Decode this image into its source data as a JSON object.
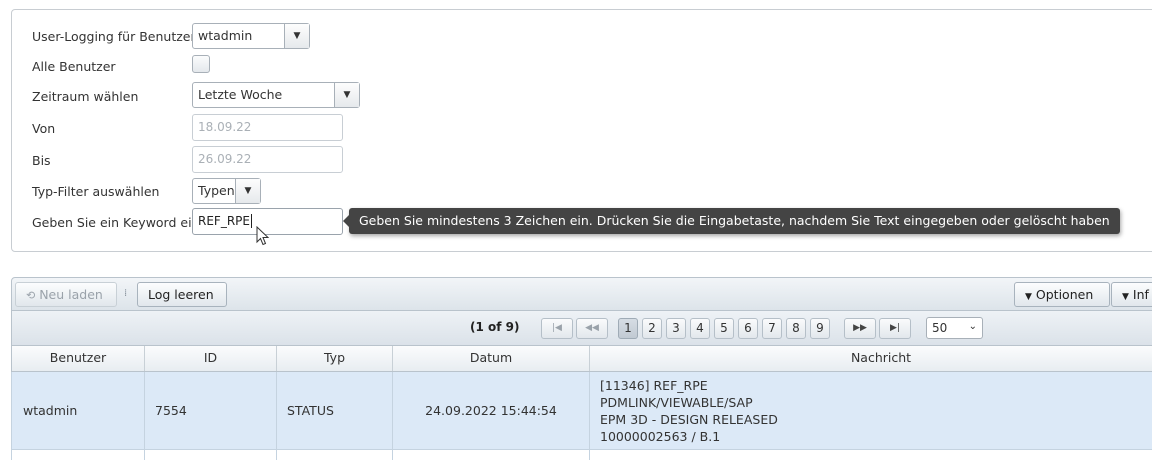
{
  "form": {
    "user_label": "User-Logging für Benutzer",
    "user_value": "wtadmin",
    "all_users_label": "Alle Benutzer",
    "period_label": "Zeitraum wählen",
    "period_value": "Letzte Woche",
    "from_label": "Von",
    "from_value": "18.09.22",
    "to_label": "Bis",
    "to_value": "26.09.22",
    "type_filter_label": "Typ-Filter auswählen",
    "type_filter_value": "Typen",
    "keyword_label": "Geben Sie ein Keyword ein",
    "keyword_value": "REF_RPE",
    "keyword_tooltip": "Geben Sie mindestens 3 Zeichen ein. Drücken Sie die Eingabetaste, nachdem Sie Text eingegeben oder gelöscht haben"
  },
  "toolbar": {
    "reload_label": "Neu laden",
    "clear_log_label": "Log leeren",
    "options_label": "Optionen",
    "info_label": "Inf"
  },
  "pager": {
    "count_text": "(1 of 9)",
    "pages": [
      "1",
      "2",
      "3",
      "4",
      "5",
      "6",
      "7",
      "8",
      "9"
    ],
    "current_page": "1",
    "page_size": "50"
  },
  "table": {
    "columns": [
      "Benutzer",
      "ID",
      "Typ",
      "Datum",
      "Nachricht"
    ],
    "rows": [
      {
        "user": "wtadmin",
        "id": "7554",
        "type": "STATUS",
        "date": "24.09.2022 15:44:54",
        "message": [
          "[11346] REF_RPE",
          "PDMLINK/VIEWABLE/SAP",
          "EPM 3D - DESIGN RELEASED",
          "10000002563 / B.1"
        ]
      }
    ]
  },
  "icons": {
    "reload": "refresh-icon",
    "dropdown": "triangle-down-icon",
    "first": "first-page-icon",
    "prev": "prev-page-icon",
    "next": "next-page-icon",
    "last": "last-page-icon",
    "grip": "toolbar-separator-icon"
  }
}
